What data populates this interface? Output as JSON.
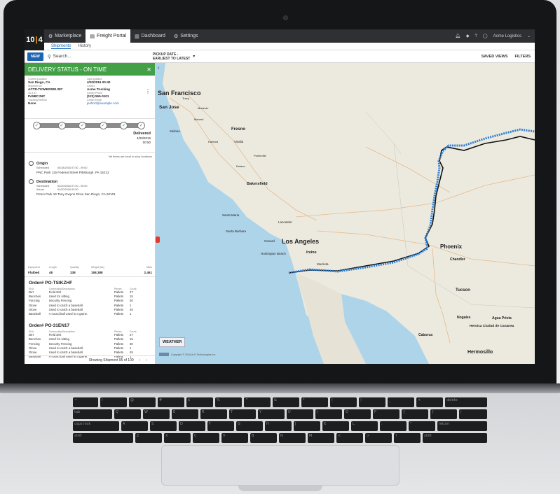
{
  "app": {
    "logo": "10|4",
    "nav": [
      {
        "label": "Marketplace",
        "icon": "gear-icon"
      },
      {
        "label": "Freight Portal",
        "icon": "document-icon"
      },
      {
        "label": "Dashboard",
        "icon": "bar-chart-icon"
      },
      {
        "label": "Settings",
        "icon": "gear-icon"
      }
    ],
    "account": "Acme Logistics",
    "subnav": [
      "Shipments",
      "History"
    ]
  },
  "toolbar": {
    "new_label": "NEW",
    "search_placeholder": "Search...",
    "pickup_line1": "PICKUP DATE -",
    "pickup_line2": "EARLIEST TO LATEST",
    "saved_views": "SAVED VIEWS",
    "filters": "FILTERS"
  },
  "status": {
    "label": "DELIVERY STATUS - ON TIME",
    "color": "#43a047"
  },
  "shipment": {
    "current_location_label": "Current Location",
    "current_location": "San Diego, CA",
    "last_updated_label": "Last Updated",
    "last_updated": "4/20/2016 00:40",
    "shipment_id_label": "Shipment ID",
    "shipment_id": "ACTR-TKW98SWE.287",
    "carrier_label": "Carrier",
    "carrier": "Acme Trucking",
    "ten4_id_label": "10-4 ID",
    "ten4_id": "PA5BCJNC",
    "carrier_phone_label": "Carrier Phone",
    "carrier_phone": "(123) 555-0101",
    "tracking_method_label": "Tracking Method",
    "tracking_method": "None",
    "carrier_email_label": "Carrier Email",
    "carrier_email": "jeshort@example.com"
  },
  "progress": {
    "steps": 6,
    "completed": 6,
    "delivered_label": "Delivered",
    "delivered_date": "4/20/2016",
    "delivered_time": "00:50"
  },
  "stops": {
    "note": "*all times are local to stop locations",
    "origin": {
      "title": "Origin",
      "scheduled_label": "Scheduled",
      "scheduled": "04/18/2016 07:00 - 09:00",
      "address": "PNC Park 115 Federal Street Pittsburgh, PA 15212"
    },
    "destination": {
      "title": "Destination",
      "scheduled_label": "Scheduled",
      "scheduled": "04/20/2016 07:00 - 09:00",
      "actual_label": "Actual",
      "actual": "04/20/2016 00:50",
      "address": "Petco Park 19 Tony Gwynn Drive San Diego, CA 92101"
    }
  },
  "equipment": {
    "headers": [
      "Equipment",
      "Length",
      "Quantity",
      "Weight (lbs)",
      "Miles"
    ],
    "values": [
      "Flatbed",
      "48",
      "338",
      "158,388",
      "2,461"
    ]
  },
  "orders": [
    {
      "title": "Order# PO-TSIKZHF",
      "headers": [
        "SKU",
        "Commodity/Description",
        "Pieces",
        "Count"
      ],
      "rows": [
        [
          "Dirt",
          "Field Dirt",
          "Pallets",
          "27"
        ],
        [
          "Benches",
          "Used for sitting",
          "Pallets",
          "15"
        ],
        [
          "Fencing",
          "Security Fencing",
          "Pallets",
          "30"
        ],
        [
          "Glove",
          "Used to catch a baseball.",
          "Pallets",
          "1"
        ],
        [
          "Glove",
          "Used to catch a baseball.",
          "Pallets",
          "45"
        ],
        [
          "Baseball",
          "A round ball used in a game.",
          "Pallets",
          "1"
        ]
      ]
    },
    {
      "title": "Order# PO-31EN17",
      "headers": [
        "SKU",
        "Commodity/Description",
        "Pieces",
        "Count"
      ],
      "rows": [
        [
          "Dirt",
          "Field Dirt",
          "Pallets",
          "27"
        ],
        [
          "Benches",
          "Used for sitting",
          "Pallets",
          "15"
        ],
        [
          "Fencing",
          "Security Fencing",
          "Pallets",
          "30"
        ],
        [
          "Glove",
          "Used to catch a baseball.",
          "Pallets",
          "1"
        ],
        [
          "Glove",
          "Used to catch a baseball.",
          "Pallets",
          "45"
        ],
        [
          "Baseball",
          "A round ball used in a game.",
          "Pallets",
          "1"
        ]
      ]
    }
  ],
  "pager": {
    "label": "Showing Shipment 95 of 100"
  },
  "map": {
    "weather_label": "WEATHER",
    "copyright": "Copyright © 2016 ALK Technologies Inc.",
    "cities_major": [
      "Los Angeles",
      "Phoenix"
    ],
    "cities": [
      "San Francisco",
      "San Jose",
      "Fresno",
      "Salinas",
      "Visalia",
      "Bakersfield",
      "Santa Maria",
      "Santa Barbara",
      "Oxnard",
      "Lancaster",
      "Huntington Beach",
      "Irvine",
      "Murrieta",
      "Chandler",
      "Tucson",
      "Nogales",
      "Agua Prieta",
      "Heroica Ciudad de Cananea",
      "Caborca",
      "Hermosillo",
      "Merced",
      "Hanford",
      "Porterville",
      "Delano",
      "Modesto",
      "Tracy"
    ]
  },
  "keyboard": {
    "row1": [
      "~",
      "!",
      "@",
      "#",
      "$",
      "%",
      "^",
      "&",
      "*",
      "(",
      ")",
      "_",
      "+",
      "delete"
    ],
    "row2": [
      "tab",
      "Q",
      "W",
      "E",
      "R",
      "T",
      "Y",
      "U",
      "I",
      "O",
      "P",
      "{",
      "}",
      "|"
    ],
    "row3": [
      "caps lock",
      "A",
      "S",
      "D",
      "F",
      "G",
      "H",
      "J",
      "K",
      "L",
      ":",
      "\"",
      "return"
    ],
    "row4": [
      "shift",
      "Z",
      "X",
      "C",
      "V",
      "B",
      "N",
      "M",
      "<",
      ">",
      "?",
      "shift"
    ],
    "row5": [
      "fn",
      "control",
      "option",
      "command",
      "",
      "command",
      "option"
    ]
  }
}
